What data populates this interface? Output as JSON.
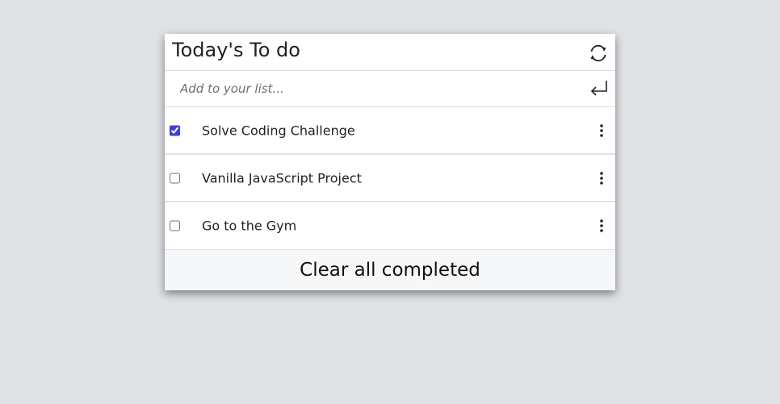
{
  "header": {
    "title": "Today's To do",
    "refresh_icon": "refresh-icon"
  },
  "add": {
    "placeholder": "Add to your list...",
    "value": "",
    "enter_icon": "enter-icon"
  },
  "items": [
    {
      "label": "Solve Coding Challenge",
      "completed": true
    },
    {
      "label": "Vanilla JavaScript Project",
      "completed": false
    },
    {
      "label": "Go to the Gym",
      "completed": false
    }
  ],
  "footer": {
    "clear_label": "Clear all completed"
  },
  "colors": {
    "background": "#dfe1e5",
    "card": "#ffffff",
    "checkbox_accent": "#3b3fd8",
    "footer": "#f6f7f8"
  }
}
